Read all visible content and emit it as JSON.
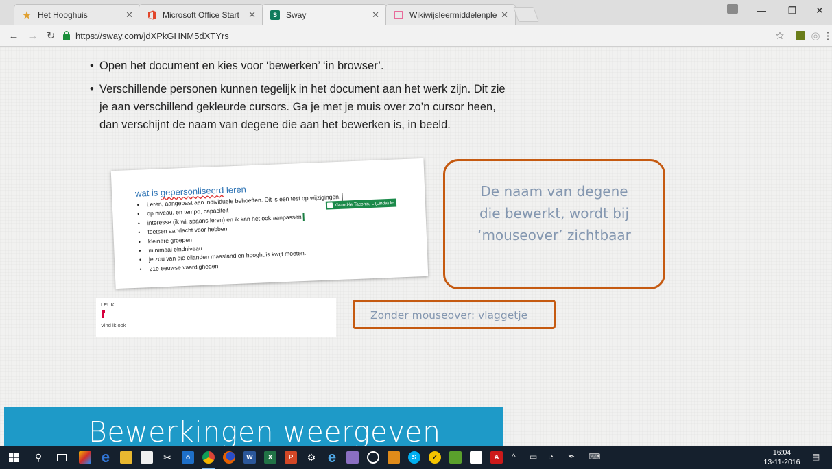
{
  "browser": {
    "tabs": [
      {
        "title": "Het Hooghuis",
        "icon": "hooghuis-star-icon",
        "color": "#e0a030"
      },
      {
        "title": "Microsoft Office Start",
        "icon": "office-icon",
        "color": "#e2462b"
      },
      {
        "title": "Sway",
        "icon": "sway-icon",
        "color": "#0f7b5c"
      },
      {
        "title": "Wikiwijsleermiddelenple",
        "icon": "wikiwijs-icon",
        "color": "#e86a9a"
      }
    ],
    "url": "https://sway.com/jdXPkGHNM5dXTYrs"
  },
  "content": {
    "bullets": [
      "Open het document en kies voor ‘bewerken’ ‘in browser’.",
      "Verschillende personen kunnen tegelijk in het document aan het werk zijn. Dit zie je aan verschillend gekleurde cursors. Ga je met je muis over zo’n cursor heen, dan verschijnt de naam van degene die aan het bewerken is, in beeld."
    ],
    "doc_title_prefix": "wat is ",
    "doc_title_misspelled": "gepersonliseerd",
    "doc_title_suffix": " leren",
    "doc_items": [
      "Leren, aangepast aan individuele behoeften. Dit is een test op wijzigingen.",
      "op niveau, en tempo, capaciteit",
      "interesse (ik wil spaans leren) en ik kan het ook aanpassen",
      "toetsen aandacht voor  hebben",
      "kleinere groepen",
      "minimaal eindniveau",
      "je zou van die eilanden maasland en hooghuis kwijt moeten.",
      "21e eeuwse  vaardigheden"
    ],
    "author_tag": "Grand-le Taconis, L (Linda) le",
    "callout_lines": [
      "De naam van degene",
      "die bewerkt, wordt bij",
      "‘mouseover’ zichtbaar"
    ],
    "comment_label": "LEUK",
    "comment_text": "Vind ik ook",
    "flag_callout": "Zonder mouseover: vlaggetje",
    "banner_heading": "Bewerkingen weergeven",
    "accent_color": "#c55a11",
    "callout_text_color": "#8497b0",
    "banner_color": "#1e9ac8"
  },
  "taskbar": {
    "time": "16:04",
    "date": "13-11-2016"
  }
}
